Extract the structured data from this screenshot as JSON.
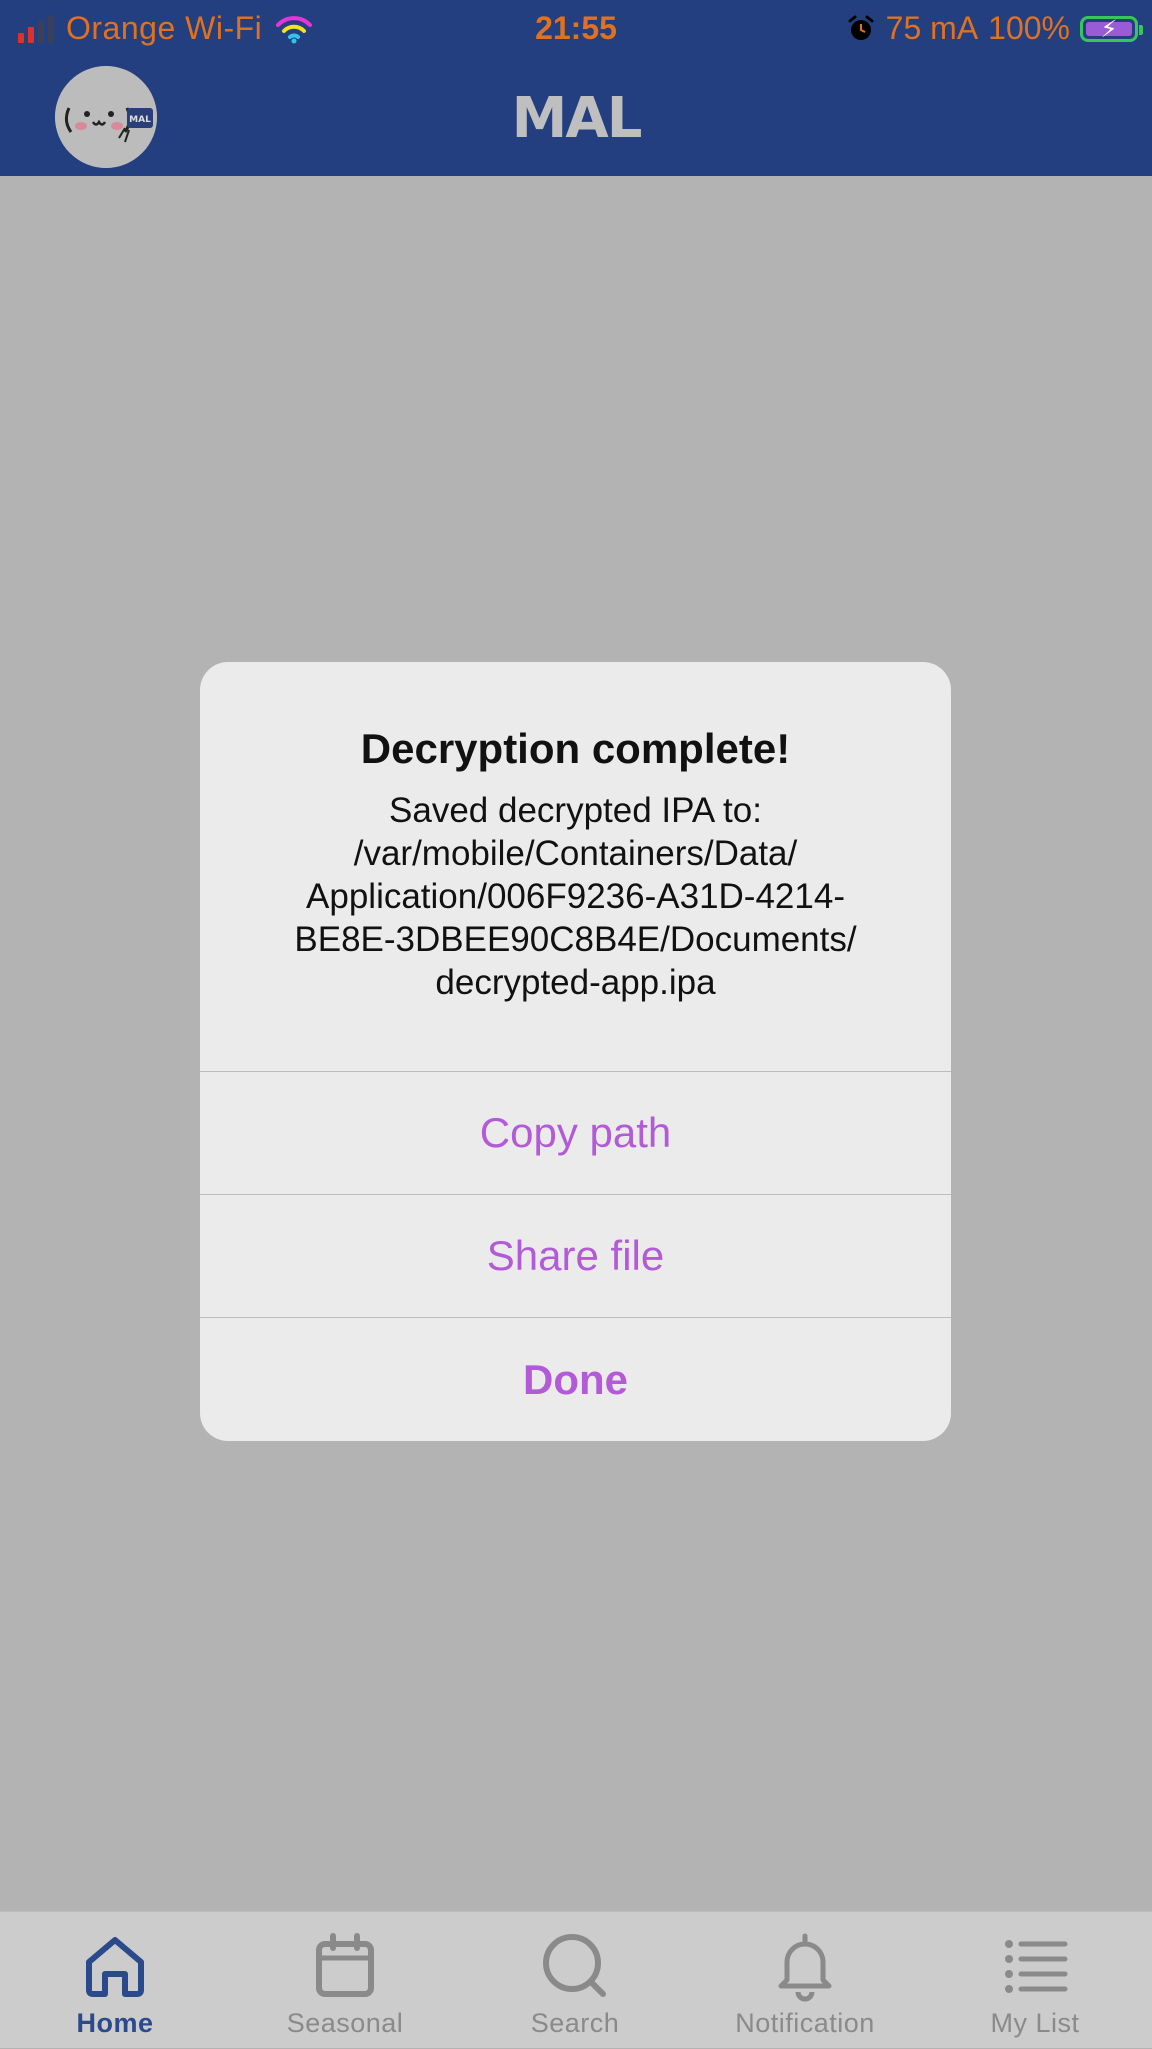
{
  "status_bar": {
    "carrier": "Orange Wi-Fi",
    "time": "21:55",
    "current": "75 mA",
    "battery": "100%",
    "battery_charging": true
  },
  "header": {
    "logo": "MAL",
    "avatar_badge": "MAL"
  },
  "alert": {
    "title": "Decryption complete!",
    "message_lines": [
      "Saved decrypted IPA to:",
      "/var/mobile/Containers/Data/",
      "Application/006F9236-A31D-4214-",
      "BE8E-3DBEE90C8B4E/Documents/",
      "decrypted-app.ipa"
    ],
    "buttons": {
      "copy": "Copy path",
      "share": "Share file",
      "done": "Done"
    }
  },
  "tabs": [
    {
      "label": "Home",
      "icon": "home-icon",
      "active": true
    },
    {
      "label": "Seasonal",
      "icon": "calendar-icon",
      "active": false
    },
    {
      "label": "Search",
      "icon": "search-icon",
      "active": false
    },
    {
      "label": "Notification",
      "icon": "bell-icon",
      "active": false
    },
    {
      "label": "My List",
      "icon": "list-icon",
      "active": false
    }
  ],
  "colors": {
    "header_bg": "#233f80",
    "accent": "#b25ad8",
    "status_text": "#e0711f",
    "active_tab": "#2a4a8c",
    "overlay": "#b3b3b3"
  }
}
